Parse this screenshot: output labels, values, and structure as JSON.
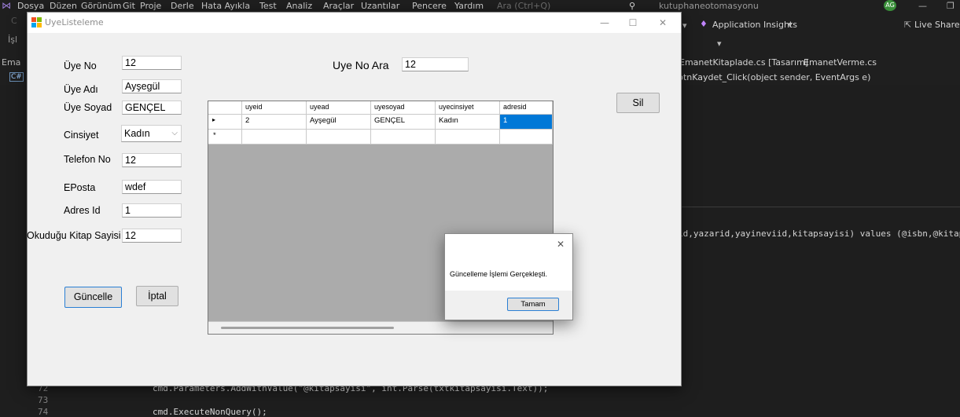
{
  "vs": {
    "menu": [
      "Dosya",
      "Düzen",
      "Görünüm",
      "Git",
      "Proje",
      "Derle",
      "Hata Ayıkla",
      "Test",
      "Analiz",
      "Araçlar",
      "Uzantılar",
      "Pencere",
      "Yardım"
    ],
    "search_placeholder": "Ara (Ctrl+Q)",
    "solution_name": "kutuphaneotomasyonu",
    "user_initials": "AG",
    "app_insights": "Application Insights",
    "live_share": "Live Share",
    "doc_tabs": [
      "EmanetKitaplade.cs [Tasarım]",
      "EmanetVerme.cs"
    ],
    "member_nav": "btnKaydet_Click(object sender, EventArgs e)",
    "code_fragment_right": "id,yazarid,yayineviid,kitapsayisi) values (@isbn,@kitapa",
    "code_lines": [
      {
        "num": "72",
        "code": "cmd.Parameters.AddWithValue(\"@kitapsayisi\", int.Parse(txtkitapsayisi.Text));"
      },
      {
        "num": "73",
        "code": ""
      },
      {
        "num": "74",
        "code": "cmd.ExecuteNonQuery();"
      }
    ],
    "left_fragments": [
      "İşl",
      "Ema",
      "C#"
    ]
  },
  "form": {
    "title": "UyeListeleme",
    "labels": {
      "uye_no": "Üye No",
      "uye_adi": "Üye Adı",
      "uye_soyad": "Üye Soyad",
      "cinsiyet": "Cinsiyet",
      "telefon": "Telefon No",
      "eposta": "EPosta",
      "adres": "Adres Id",
      "kitap": "Okuduğu Kitap Sayisi",
      "ara": "Uye No Ara"
    },
    "values": {
      "uye_no": "12",
      "uye_adi": "Ayşegül",
      "uye_soyad": "GENÇEL",
      "cinsiyet": "Kadın",
      "telefon": "12",
      "eposta": "wdef",
      "adres": "1",
      "kitap": "12",
      "ara": "12"
    },
    "buttons": {
      "guncelle": "Güncelle",
      "iptal": "İptal",
      "sil": "Sil"
    },
    "grid": {
      "columns": [
        "uyeid",
        "uyead",
        "uyesoyad",
        "uyecinsiyet",
        "adresid"
      ],
      "rows": [
        [
          "2",
          "Ayşegül",
          "GENÇEL",
          "Kadın",
          "1"
        ]
      ],
      "current_row_glyph": "▸",
      "new_row_glyph": "*"
    }
  },
  "message_box": {
    "text": "Güncelleme İşlemi Gerçekleşti.",
    "ok": "Tamam"
  },
  "colors": {
    "selection": "#0078d7",
    "vs_bg": "#1f1f1f",
    "form_bg": "#f0f0f0"
  }
}
